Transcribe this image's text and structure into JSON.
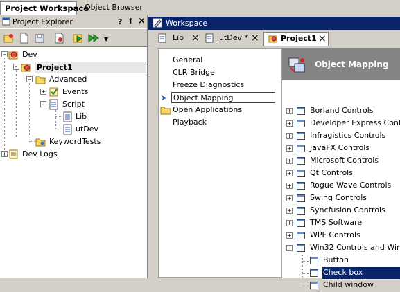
{
  "top_tabs": [
    "Project Workspace",
    "Object Browser"
  ],
  "explorer": {
    "title": "Project Explorer",
    "controls": [
      "?",
      "↑",
      "×"
    ],
    "tree": [
      {
        "label": "Dev"
      },
      {
        "label": "Project1"
      },
      {
        "label": "Advanced"
      },
      {
        "label": "Events"
      },
      {
        "label": "Script"
      },
      {
        "label": "Lib"
      },
      {
        "label": "utDev"
      },
      {
        "label": "KeywordTests"
      },
      {
        "label": "Dev Logs"
      }
    ]
  },
  "workspace": {
    "title": "Workspace",
    "tabs": [
      {
        "label": "Lib"
      },
      {
        "label": "utDev *"
      },
      {
        "label": "Project1"
      }
    ],
    "close_symbol": "×",
    "categories": [
      "General",
      "CLR Bridge",
      "Freeze Diagnostics",
      "Object Mapping",
      "Open Applications",
      "Playback"
    ],
    "selected_category": "Object Mapping",
    "object_mapping": {
      "header": "Object Mapping",
      "groups": [
        "Borland Controls",
        "Developer Express Cont...",
        "Infragistics Controls",
        "JavaFX Controls",
        "Microsoft Controls",
        "Qt Controls",
        "Rogue Wave Controls",
        "Swing Controls",
        "Syncfusion Controls",
        "TMS Software",
        "WPF Controls",
        "Win32 Controls and Win..."
      ],
      "children": [
        "Button",
        "Check box",
        "Child window"
      ],
      "selected_child": "Check box"
    }
  },
  "colors": {
    "title_active": "#0a246a",
    "selection": "#0a246a",
    "panel_bg": "#d4d0c8",
    "header_gray": "#848484"
  }
}
